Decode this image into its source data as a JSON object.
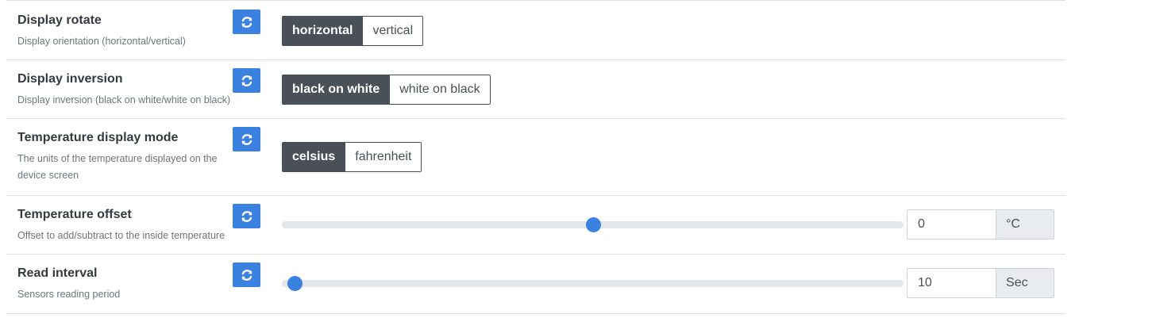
{
  "settings": [
    {
      "title": "Display rotate",
      "description": "Display orientation (horizontal/vertical)",
      "type": "toggle",
      "options": [
        "horizontal",
        "vertical"
      ],
      "selected": "horizontal"
    },
    {
      "title": "Display inversion",
      "description": "Display inversion (black on white/white on black)",
      "type": "toggle",
      "options": [
        "black on white",
        "white on black"
      ],
      "selected": "black on white"
    },
    {
      "title": "Temperature display mode",
      "description": "The units of the temperature displayed on the device screen",
      "type": "toggle",
      "options": [
        "celsius",
        "fahrenheit"
      ],
      "selected": "celsius"
    },
    {
      "title": "Temperature offset",
      "description": "Offset to add/subtract to the inside temperature",
      "type": "slider",
      "value": "0",
      "unit": "°C",
      "slider_fraction": 0.5
    },
    {
      "title": "Read interval",
      "description": "Sensors reading period",
      "type": "slider",
      "value": "10",
      "unit": "Sec",
      "slider_fraction": 0.02
    }
  ],
  "icons": {
    "refresh": "refresh-icon"
  },
  "colors": {
    "accent": "#3b82e0",
    "toggle_active": "#495057"
  }
}
